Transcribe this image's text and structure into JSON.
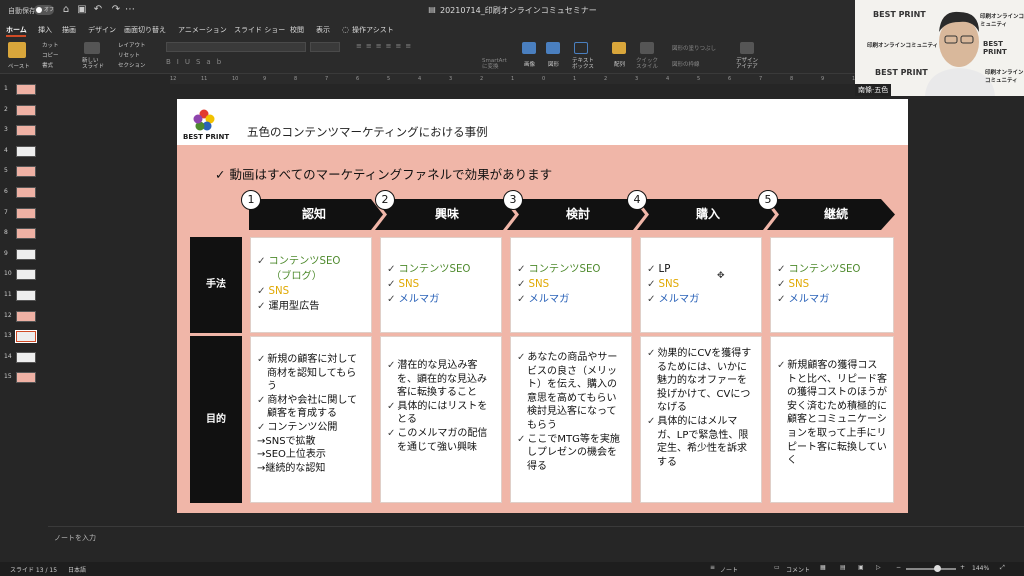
{
  "titlebar": {
    "autosave_label": "自動保存",
    "autosave_state": "オフ",
    "doc_title": "20210714_印刷オンラインコミュセミナー"
  },
  "tabs": [
    "ホーム",
    "挿入",
    "描画",
    "デザイン",
    "画面切り替え",
    "アニメーション",
    "スライド ショー",
    "校閲",
    "表示",
    "操作アシスト"
  ],
  "ribbon": {
    "paste": "ペースト",
    "cut": "カット",
    "copy": "コピー",
    "format": "書式",
    "new_slide": "新しい\nスライド",
    "layout": "レイアウト",
    "reset": "リセット",
    "section": "セクション",
    "convert_smartart": "SmartArt\nに変換",
    "image": "画像",
    "shape": "図形",
    "textbox": "テキスト\nボックス",
    "arrange": "配列",
    "quick_style": "クイック\nスタイル",
    "shape_fill": "図形の塗りつぶし",
    "shape_outline": "図形の枠線",
    "design_ideas": "デザイン\nアイデア"
  },
  "thumbnails": [
    "1",
    "2",
    "3",
    "4",
    "5",
    "6",
    "7",
    "8",
    "9",
    "10",
    "11",
    "12",
    "13",
    "14",
    "15"
  ],
  "selected_slide_index": 12,
  "slide": {
    "logo_text": "BEST PRINT",
    "title": "五色のコンテンツマーケティングにおける事例",
    "subtitle": "✓ 動画はすべてのマーケティングファネルで効果があります",
    "steps": [
      {
        "num": "1",
        "label": "認知"
      },
      {
        "num": "2",
        "label": "興味"
      },
      {
        "num": "3",
        "label": "検討"
      },
      {
        "num": "4",
        "label": "購入"
      },
      {
        "num": "5",
        "label": "継続"
      }
    ],
    "row_method": "手法",
    "row_purpose": "目的",
    "methods": [
      [
        {
          "t": "コンテンツSEO",
          "c": "green"
        },
        {
          "t": "（ブログ）",
          "c": "green",
          "indent": true
        },
        {
          "t": "SNS",
          "c": "yellow"
        },
        {
          "t": "運用型広告",
          "c": "black"
        }
      ],
      [
        {
          "t": "コンテンツSEO",
          "c": "green"
        },
        {
          "t": "SNS",
          "c": "yellow"
        },
        {
          "t": "メルマガ",
          "c": "blue"
        }
      ],
      [
        {
          "t": "コンテンツSEO",
          "c": "green"
        },
        {
          "t": "SNS",
          "c": "yellow"
        },
        {
          "t": "メルマガ",
          "c": "blue"
        }
      ],
      [
        {
          "t": "LP",
          "c": "black"
        },
        {
          "t": "SNS",
          "c": "yellow"
        },
        {
          "t": "メルマガ",
          "c": "blue"
        }
      ],
      [
        {
          "t": "コンテンツSEO",
          "c": "green"
        },
        {
          "t": "SNS",
          "c": "yellow"
        },
        {
          "t": "メルマガ",
          "c": "blue"
        }
      ]
    ],
    "purposes": [
      [
        {
          "t": "新規の顧客に対して商材を認知してもらう",
          "b": true
        },
        {
          "t": "商材や会社に関して顧客を育成する",
          "b": true
        },
        {
          "t": "コンテンツ公開",
          "b": true
        },
        {
          "t": "→SNSで拡散",
          "b": false
        },
        {
          "t": "→SEO上位表示",
          "b": false
        },
        {
          "t": "→継続的な認知",
          "b": false
        }
      ],
      [
        {
          "t": "潜在的な見込み客を、顕在的な見込み客に転換すること",
          "b": true
        },
        {
          "t": "具体的にはリストをとる",
          "b": true
        },
        {
          "t": "このメルマガの配信を通じて強い興味",
          "b": true
        }
      ],
      [
        {
          "t": "あなたの商品やサービスの良さ（メリット）を伝え、購入の意思を高めてもらい検討見込客になってもらう",
          "b": true
        },
        {
          "t": "ここでMTG等を実施しプレゼンの機会を得る",
          "b": true
        }
      ],
      [
        {
          "t": "効果的にCVを獲得するためには、いかに魅力的なオファーを投げかけて、CVにつなげる",
          "b": true
        },
        {
          "t": "具体的にはメルマガ、LPで緊急性、限定生、希少性を訴求する",
          "b": true
        }
      ],
      [
        {
          "t": "新規顧客の獲得コストと比べ、リピード客の獲得コストのほうが安く済むため積極的に顧客とコミュニケーションを取って上手にリピート客に転換していく",
          "b": true
        }
      ]
    ]
  },
  "notes_placeholder": "ノートを入力",
  "status": {
    "slide_pos": "スライド 13 / 15",
    "language": "日本語",
    "notes": "ノート",
    "comments": "コメント",
    "zoom": "144%"
  },
  "webcam": {
    "name_tag": "南條·五色",
    "overlay_logo": "BEST PRINT",
    "overlay_text": "印刷オンラインコミュニティ"
  },
  "colors": {
    "accent": "#d04b26",
    "slide_bg": "#f0b6a8",
    "green": "#4e8a2d",
    "yellow": "#e0a800",
    "blue": "#2a62b8"
  }
}
